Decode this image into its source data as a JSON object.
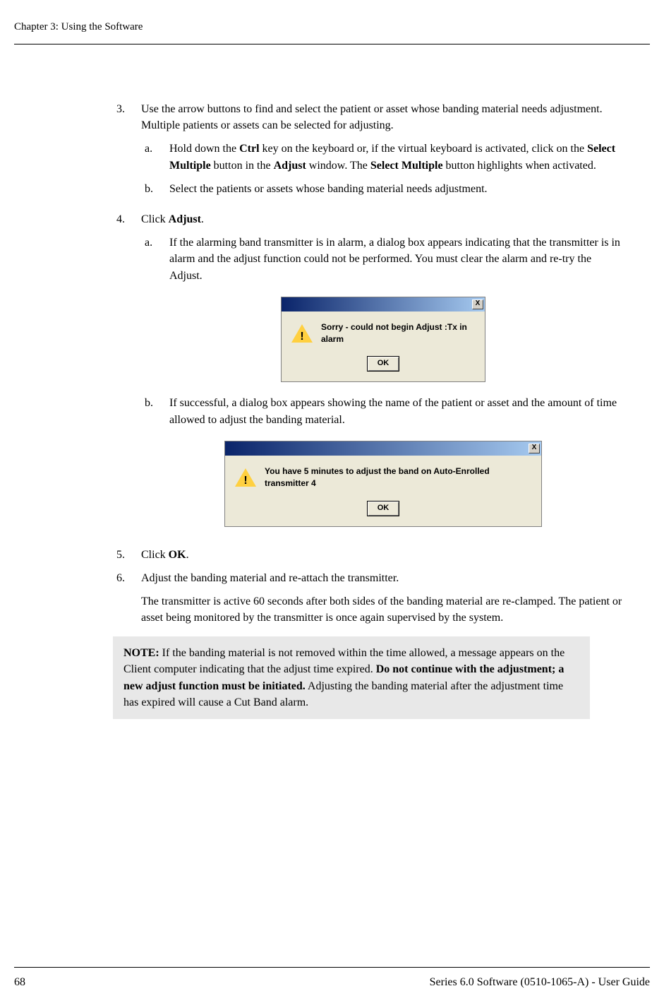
{
  "header": "Chapter 3: Using the Software",
  "step3": {
    "num": "3.",
    "text": "Use the arrow buttons to find and select the patient or asset whose banding material needs adjustment. Multiple patients or assets can be selected for adjusting.",
    "a": {
      "letter": "a.",
      "t1": "Hold down the ",
      "b1": "Ctrl",
      "t2": " key on the keyboard or, if the virtual keyboard is activated, click on the ",
      "b2": "Select Multiple",
      "t3": " button in the ",
      "b3": "Adjust",
      "t4": " window. The ",
      "b4": "Select Multiple",
      "t5": " button highlights when activated."
    },
    "b": {
      "letter": "b.",
      "text": "Select the patients or assets whose banding material needs adjustment."
    }
  },
  "step4": {
    "num": "4.",
    "t1": "Click ",
    "b1": "Adjust",
    "t2": ".",
    "a": {
      "letter": "a.",
      "text": "If the alarming band transmitter is in alarm, a dialog box appears indicating that the transmitter is in alarm and the adjust function could not be performed. You must clear the alarm and re-try the Adjust."
    },
    "b": {
      "letter": "b.",
      "text": "If successful, a dialog box appears showing the name of the patient or asset and the amount of time allowed to adjust the banding material."
    }
  },
  "dialog1": {
    "msg": "Sorry - could not begin Adjust :Tx in alarm",
    "ok": "OK",
    "close": "X",
    "bang": "!"
  },
  "dialog2": {
    "msg": "You have 5 minutes to adjust the band on Auto-Enrolled transmitter 4",
    "ok": "OK",
    "close": "X",
    "bang": "!"
  },
  "step5": {
    "num": "5.",
    "t1": "Click ",
    "b1": "OK",
    "t2": "."
  },
  "step6": {
    "num": "6.",
    "text": "Adjust the banding material and re-attach the transmitter.",
    "follow": "The transmitter is active 60 seconds after both sides of the banding material are re-clamped. The patient or asset being monitored by the transmitter is once again supervised by the system."
  },
  "note": {
    "label": "NOTE:",
    "t1": " If the banding material is not removed within the time allowed, a message appears on the Client computer indicating that the adjust time expired. ",
    "b1": "Do not continue with the adjustment; a new adjust function must be initiated.",
    "t2": " Adjusting the banding material after the adjustment time has expired will cause a Cut Band alarm."
  },
  "footer": {
    "page": "68",
    "doc": "Series 6.0 Software (0510-1065-A) - User Guide"
  }
}
